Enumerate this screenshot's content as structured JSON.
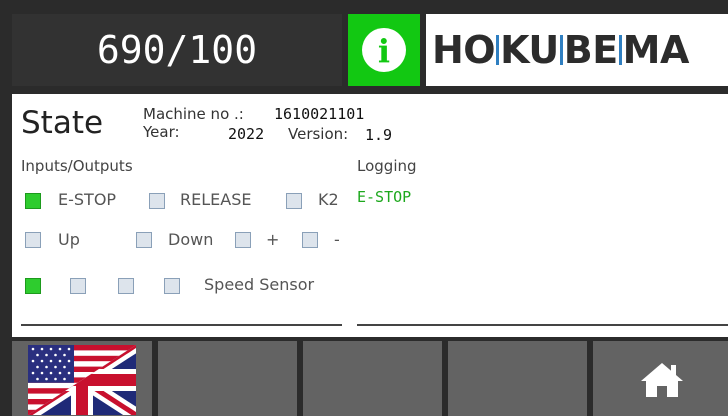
{
  "header": {
    "counter": "690/100",
    "info_glyph": "i",
    "brand": {
      "part1": "HO",
      "part2": "KU",
      "part3": "BE",
      "part4": "MA"
    },
    "colors": {
      "info_green": "#12c812",
      "brand_blue": "#2f7fc1"
    }
  },
  "state": {
    "title": "State",
    "machine_label": "Machine no .:",
    "machine_no": "1610021101",
    "year_label": "Year:",
    "year": "2022",
    "version_label": "Version:",
    "version": "1.9"
  },
  "io": {
    "label": "Inputs/Outputs",
    "row1": [
      {
        "label": "E-STOP",
        "on": true
      },
      {
        "label": "RELEASE",
        "on": false
      },
      {
        "label": "K2",
        "on": false
      }
    ],
    "row2": [
      {
        "label": "Up",
        "on": false
      },
      {
        "label": "Down",
        "on": false
      },
      {
        "label": "+",
        "on": false
      },
      {
        "label": "-",
        "on": false
      }
    ],
    "row3": [
      {
        "label": "",
        "on": true
      },
      {
        "label": "",
        "on": false
      },
      {
        "label": "",
        "on": false
      },
      {
        "label": "Speed Sensor",
        "on": false
      }
    ]
  },
  "logging": {
    "label": "Logging",
    "entries": [
      "E-STOP"
    ]
  },
  "footer": {
    "buttons": [
      "language-flag-uk-us",
      "",
      "",
      "",
      "home-icon"
    ]
  }
}
